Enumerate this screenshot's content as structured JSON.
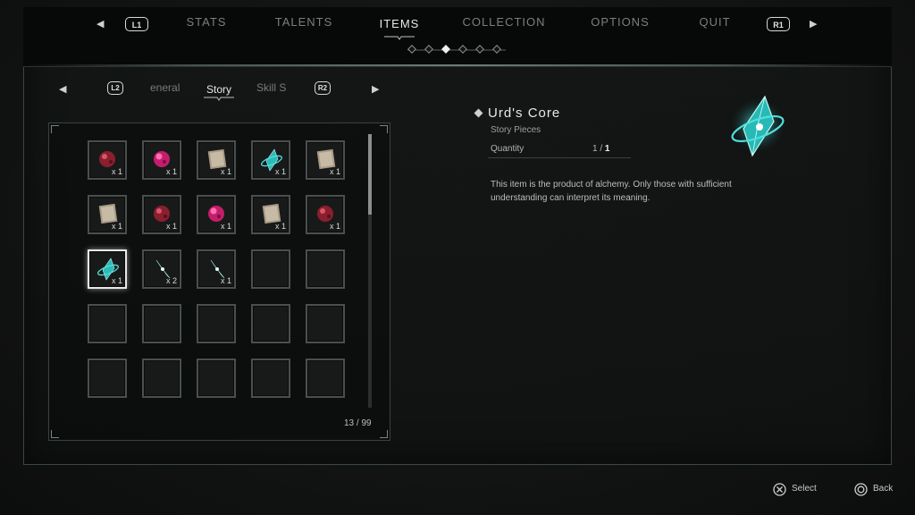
{
  "nav": {
    "left_bumper": "L1",
    "right_bumper": "R1",
    "tabs": [
      {
        "label": "STATS",
        "active": false
      },
      {
        "label": "TALENTS",
        "active": false
      },
      {
        "label": "ITEMS",
        "active": true
      },
      {
        "label": "COLLECTION",
        "active": false
      },
      {
        "label": "OPTIONS",
        "active": false
      },
      {
        "label": "QUIT",
        "active": false
      }
    ],
    "page_dots": 6,
    "active_dot": 3
  },
  "subnav": {
    "left_trigger": "L2",
    "right_trigger": "R2",
    "tabs": [
      {
        "label": "eneral",
        "active": false
      },
      {
        "label": "Story",
        "active": true
      },
      {
        "label": "Skill S",
        "active": false
      }
    ]
  },
  "inventory": {
    "slots": [
      {
        "item": "red-orb-icon",
        "qty": "x 1"
      },
      {
        "item": "pink-orb-icon",
        "qty": "x 1"
      },
      {
        "item": "paper-note-icon",
        "qty": "x 1"
      },
      {
        "item": "cyan-crystal-ring-icon",
        "qty": "x 1"
      },
      {
        "item": "paper-note-icon",
        "qty": "x 1"
      },
      {
        "item": "paper-note-icon",
        "qty": "x 1"
      },
      {
        "item": "red-orb-icon",
        "qty": "x 1"
      },
      {
        "item": "pink-orb-icon",
        "qty": "x 1"
      },
      {
        "item": "paper-note-icon",
        "qty": "x 1"
      },
      {
        "item": "red-orb-icon",
        "qty": "x 1"
      },
      {
        "item": "cyan-crystal-ring-icon",
        "qty": "x 1",
        "selected": true
      },
      {
        "item": "cyan-crystal-shard-icon",
        "qty": "x 2"
      },
      {
        "item": "cyan-crystal-shard-icon",
        "qty": "x 1"
      },
      {
        "item": null,
        "qty": ""
      },
      {
        "item": null,
        "qty": ""
      },
      {
        "item": null,
        "qty": ""
      },
      {
        "item": null,
        "qty": ""
      },
      {
        "item": null,
        "qty": ""
      },
      {
        "item": null,
        "qty": ""
      },
      {
        "item": null,
        "qty": ""
      },
      {
        "item": null,
        "qty": ""
      },
      {
        "item": null,
        "qty": ""
      },
      {
        "item": null,
        "qty": ""
      },
      {
        "item": null,
        "qty": ""
      },
      {
        "item": null,
        "qty": ""
      }
    ],
    "counter": "13 / 99"
  },
  "detail": {
    "name": "Urd's Core",
    "category": "Story Pieces",
    "quantity_label": "Quantity",
    "quantity_owned": "1",
    "quantity_sep": " / ",
    "quantity_max": "1",
    "description": "This item is the product of alchemy. Only those with sufficient understanding can interpret its meaning.",
    "icon": "urds-core-crystal-icon"
  },
  "footer": {
    "select_label": "Select",
    "back_label": "Back"
  },
  "colors": {
    "accent_cyan": "#3fd6d2",
    "text_primary": "#e8e8e8",
    "text_muted": "#7d7d7d"
  }
}
